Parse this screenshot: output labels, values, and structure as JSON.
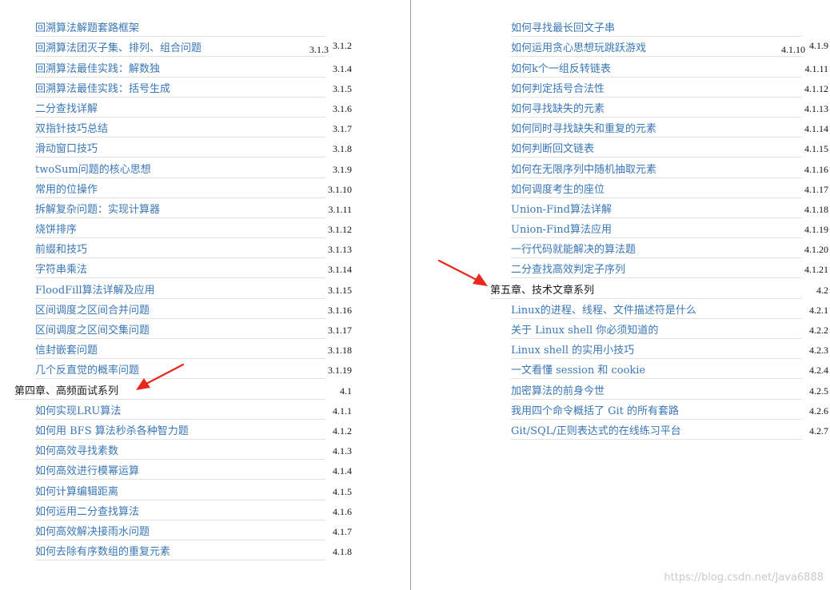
{
  "toc_left": [
    {
      "title": "回溯算法解题套路框架",
      "num": "",
      "type": "entry"
    },
    {
      "title": "回溯算法团灭子集、排列、组合问题",
      "num_a": "3.1.3",
      "num": "3.1.2",
      "type": "entry"
    },
    {
      "title": "回溯算法最佳实践：解数独",
      "num": "3.1.4",
      "type": "entry"
    },
    {
      "title": "回溯算法最佳实践：括号生成",
      "num": "3.1.5",
      "type": "entry"
    },
    {
      "title": "二分查找详解",
      "num": "3.1.6",
      "type": "entry"
    },
    {
      "title": "双指针技巧总结",
      "num": "3.1.7",
      "type": "entry"
    },
    {
      "title": "滑动窗口技巧",
      "num": "3.1.8",
      "type": "entry"
    },
    {
      "title": "twoSum问题的核心思想",
      "num": "3.1.9",
      "type": "entry"
    },
    {
      "title": "常用的位操作",
      "num": "3.1.10",
      "type": "entry"
    },
    {
      "title": "拆解复杂问题：实现计算器",
      "num": "3.1.11",
      "type": "entry"
    },
    {
      "title": "烧饼排序",
      "num": "3.1.12",
      "type": "entry"
    },
    {
      "title": "前缀和技巧",
      "num": "3.1.13",
      "type": "entry"
    },
    {
      "title": "字符串乘法",
      "num": "3.1.14",
      "type": "entry"
    },
    {
      "title": "FloodFill算法详解及应用",
      "num": "3.1.15",
      "type": "entry"
    },
    {
      "title": "区间调度之区间合并问题",
      "num": "3.1.16",
      "type": "entry"
    },
    {
      "title": "区间调度之区间交集问题",
      "num": "3.1.17",
      "type": "entry"
    },
    {
      "title": "信封嵌套问题",
      "num": "3.1.18",
      "type": "entry"
    },
    {
      "title": "几个反直觉的概率问题",
      "num": "3.1.19",
      "type": "entry"
    },
    {
      "title": "第四章、高频面试系列",
      "num": "4.1",
      "type": "chapter"
    },
    {
      "title": "如何实现LRU算法",
      "num": "4.1.1",
      "type": "entry"
    },
    {
      "title": "如何用 BFS 算法秒杀各种智力题",
      "num": "4.1.2",
      "type": "entry"
    },
    {
      "title": "如何高效寻找素数",
      "num": "4.1.3",
      "type": "entry"
    },
    {
      "title": "如何高效进行模幂运算",
      "num": "4.1.4",
      "type": "entry"
    },
    {
      "title": "如何计算编辑距离",
      "num": "4.1.5",
      "type": "entry"
    },
    {
      "title": "如何运用二分查找算法",
      "num": "4.1.6",
      "type": "entry"
    },
    {
      "title": "如何高效解决接雨水问题",
      "num": "4.1.7",
      "type": "entry"
    },
    {
      "title": "如何去除有序数组的重复元素",
      "num": "4.1.8",
      "type": "entry"
    }
  ],
  "toc_right": [
    {
      "title": "如何寻找最长回文子串",
      "num": "",
      "type": "entry"
    },
    {
      "title": "如何运用贪心思想玩跳跃游戏",
      "num_a": "4.1.10",
      "num": "4.1.9",
      "type": "entry"
    },
    {
      "title": "如何k个一组反转链表",
      "num": "4.1.11",
      "type": "entry"
    },
    {
      "title": "如何判定括号合法性",
      "num": "4.1.12",
      "type": "entry"
    },
    {
      "title": "如何寻找缺失的元素",
      "num": "4.1.13",
      "type": "entry"
    },
    {
      "title": "如何同时寻找缺失和重复的元素",
      "num": "4.1.14",
      "type": "entry"
    },
    {
      "title": "如何判断回文链表",
      "num": "4.1.15",
      "type": "entry"
    },
    {
      "title": "如何在无限序列中随机抽取元素",
      "num": "4.1.16",
      "type": "entry"
    },
    {
      "title": "如何调度考生的座位",
      "num": "4.1.17",
      "type": "entry"
    },
    {
      "title": "Union-Find算法详解",
      "num": "4.1.18",
      "type": "entry"
    },
    {
      "title": "Union-Find算法应用",
      "num": "4.1.19",
      "type": "entry"
    },
    {
      "title": "一行代码就能解决的算法题",
      "num": "4.1.20",
      "type": "entry"
    },
    {
      "title": "二分查找高效判定子序列",
      "num": "4.1.21",
      "type": "entry"
    },
    {
      "title": "第五章、技术文章系列",
      "num": "4.2",
      "type": "chapter"
    },
    {
      "title": "Linux的进程、线程、文件描述符是什么",
      "num": "4.2.1",
      "type": "entry"
    },
    {
      "title": "关于 Linux shell 你必须知道的",
      "num": "4.2.2",
      "type": "entry"
    },
    {
      "title": "Linux shell 的实用小技巧",
      "num": "4.2.3",
      "type": "entry"
    },
    {
      "title": "一文看懂 session 和 cookie",
      "num": "4.2.4",
      "type": "entry"
    },
    {
      "title": "加密算法的前身今世",
      "num": "4.2.5",
      "type": "entry"
    },
    {
      "title": "我用四个命令概括了 Git 的所有套路",
      "num": "4.2.6",
      "type": "entry"
    },
    {
      "title": "Git/SQL/正则表达式的在线练习平台",
      "num": "4.2.7",
      "type": "entry"
    }
  ],
  "watermark": "https://blog.csdn.net/Java6888",
  "colors": {
    "link": "#3a76b5",
    "chapter": "#1c1c1c",
    "arrow": "#e8281e",
    "divider": "#9a9a9a"
  }
}
